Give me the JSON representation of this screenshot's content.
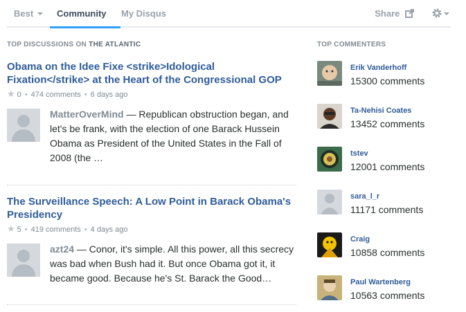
{
  "nav": {
    "tabs": [
      {
        "label": "Best"
      },
      {
        "label": "Community"
      },
      {
        "label": "My Disqus"
      }
    ],
    "share_label": "Share",
    "settings_icon": "gear-icon"
  },
  "left": {
    "header_prefix": "Top Discussions on",
    "header_site": "The Atlantic",
    "discussions": [
      {
        "title": "Obama on the Idee Fixe <strike>Idological Fixation</strike> at the Heart of the Congressional GOP",
        "likes": "0",
        "comments": "474 comments",
        "age": "6 days ago",
        "comment_author": "MatterOverMind",
        "comment_text": " — Republican obstruction began, and let's be frank, with the election of one Barack Hussein Obama as President of the United States in the Fall of 2008 (the …"
      },
      {
        "title": "The Surveillance Speech: A Low Point in Barack Obama's Presidency",
        "likes": "5",
        "comments": "419 comments",
        "age": "4 days ago",
        "comment_author": "azt24",
        "comment_text": " — Conor, it's simple. All this power, all this secrecy was bad when Bush had it. But once Obama got it, it became good. Because he's St. Barack the Good…"
      }
    ]
  },
  "right": {
    "header": "Top Commenters",
    "commenters": [
      {
        "name": "Erik Vanderhoff",
        "count": "15300 comments"
      },
      {
        "name": "Ta-Nehisi Coates",
        "count": "13452 comments"
      },
      {
        "name": "tstev",
        "count": "12001 comments"
      },
      {
        "name": "sara_l_r",
        "count": "11171 comments"
      },
      {
        "name": "Craig",
        "count": "10858 comments"
      },
      {
        "name": "Paul Wartenberg",
        "count": "10563 comments"
      }
    ]
  },
  "colors": {
    "link": "#2f5c99",
    "accent": "#2e9fff",
    "muted": "#7f8a93"
  }
}
